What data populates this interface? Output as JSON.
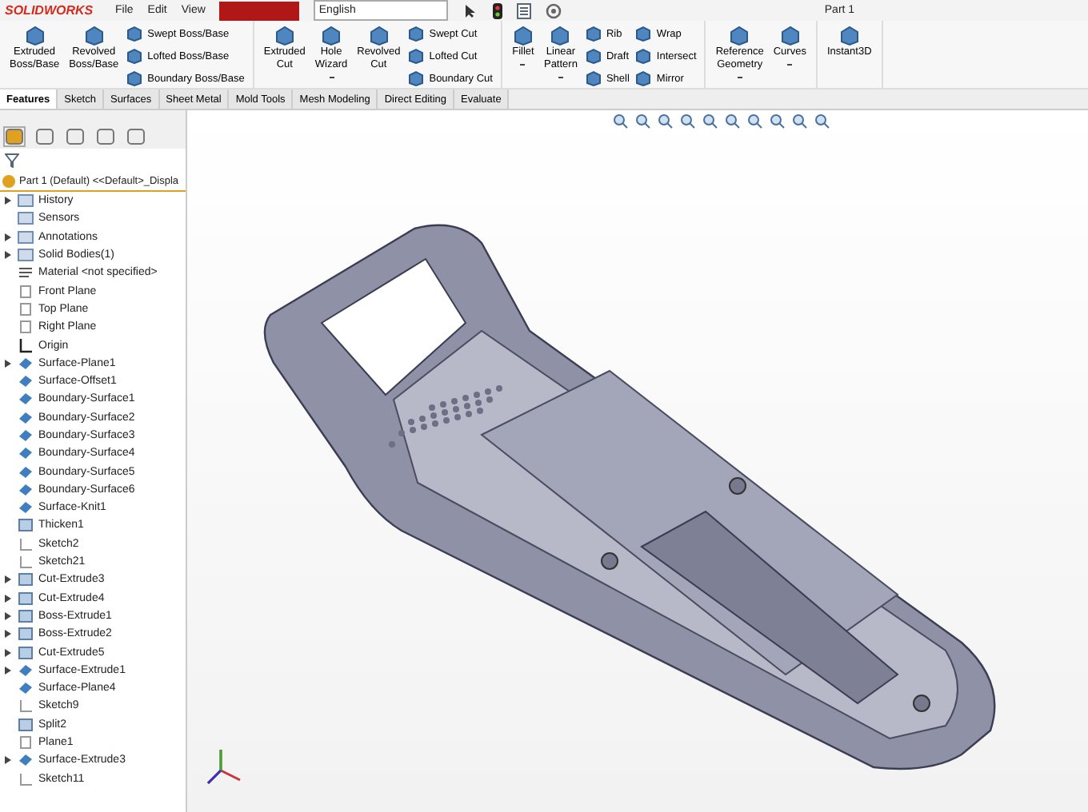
{
  "window": {
    "logo": "SOLIDWORKS",
    "title": "Part 1",
    "menus": [
      "File",
      "Edit",
      "View"
    ],
    "language": "English"
  },
  "ribbon": {
    "groups": [
      {
        "items": [
          {
            "kind": "large",
            "lines": [
              "Extruded",
              "Boss/Base"
            ],
            "dropdown": false
          },
          {
            "kind": "large",
            "lines": [
              "Revolved",
              "Boss/Base"
            ],
            "dropdown": false
          },
          {
            "kind": "stack",
            "labels": [
              "Swept Boss/Base",
              "Lofted Boss/Base",
              "Boundary Boss/Base"
            ]
          }
        ]
      },
      {
        "items": [
          {
            "kind": "large",
            "lines": [
              "Extruded",
              "Cut"
            ],
            "dropdown": false
          },
          {
            "kind": "large",
            "lines": [
              "Hole",
              "Wizard"
            ],
            "dropdown": true
          },
          {
            "kind": "large",
            "lines": [
              "Revolved",
              "Cut"
            ],
            "dropdown": false
          },
          {
            "kind": "stack",
            "labels": [
              "Swept Cut",
              "Lofted Cut",
              "Boundary Cut"
            ]
          }
        ]
      },
      {
        "items": [
          {
            "kind": "large",
            "lines": [
              "Fillet"
            ],
            "dropdown": true
          },
          {
            "kind": "large",
            "lines": [
              "Linear",
              "Pattern"
            ],
            "dropdown": true
          },
          {
            "kind": "stack",
            "labels": [
              "Rib",
              "Draft",
              "Shell"
            ]
          },
          {
            "kind": "stack",
            "labels": [
              "Wrap",
              "Intersect",
              "Mirror"
            ]
          }
        ]
      },
      {
        "items": [
          {
            "kind": "large",
            "lines": [
              "Reference",
              "Geometry"
            ],
            "dropdown": true
          },
          {
            "kind": "large",
            "lines": [
              "Curves"
            ],
            "dropdown": true
          }
        ]
      },
      {
        "items": [
          {
            "kind": "large",
            "lines": [
              "Instant3D"
            ],
            "dropdown": false
          }
        ]
      }
    ]
  },
  "tabs": [
    {
      "label": "Features",
      "selected": true
    },
    {
      "label": "Sketch",
      "selected": false
    },
    {
      "label": "Surfaces",
      "selected": false
    },
    {
      "label": "Sheet Metal",
      "selected": false
    },
    {
      "label": "Mold Tools",
      "selected": false
    },
    {
      "label": "Mesh Modeling",
      "selected": false
    },
    {
      "label": "Direct Editing",
      "selected": false
    },
    {
      "label": "Evaluate",
      "selected": false
    }
  ],
  "tree": {
    "root": "Part 1 (Default) <<Default>_Displa",
    "items": [
      {
        "label": "History",
        "kind": "folder",
        "expandable": true
      },
      {
        "label": "Sensors",
        "kind": "folder",
        "expandable": false
      },
      {
        "label": "Annotations",
        "kind": "folder",
        "expandable": true
      },
      {
        "label": "Solid Bodies(1)",
        "kind": "folder",
        "expandable": true
      },
      {
        "label": "Material <not specified>",
        "kind": "material",
        "expandable": false
      },
      {
        "label": "Front Plane",
        "kind": "plane",
        "expandable": false
      },
      {
        "label": "Top Plane",
        "kind": "plane",
        "expandable": false
      },
      {
        "label": "Right Plane",
        "kind": "plane",
        "expandable": false
      },
      {
        "label": "Origin",
        "kind": "origin",
        "expandable": false
      },
      {
        "label": "Surface-Plane1",
        "kind": "surface",
        "expandable": true
      },
      {
        "label": "Surface-Offset1",
        "kind": "surface",
        "expandable": false
      },
      {
        "label": "Boundary-Surface1",
        "kind": "surface",
        "expandable": false
      },
      {
        "label": "Boundary-Surface2",
        "kind": "surface",
        "expandable": false
      },
      {
        "label": "Boundary-Surface3",
        "kind": "surface",
        "expandable": false
      },
      {
        "label": "Boundary-Surface4",
        "kind": "surface",
        "expandable": false
      },
      {
        "label": "Boundary-Surface5",
        "kind": "surface",
        "expandable": false
      },
      {
        "label": "Boundary-Surface6",
        "kind": "surface",
        "expandable": false
      },
      {
        "label": "Surface-Knit1",
        "kind": "surface",
        "expandable": false
      },
      {
        "label": "Thicken1",
        "kind": "feature",
        "expandable": false
      },
      {
        "label": "Sketch2",
        "kind": "sketch",
        "expandable": false
      },
      {
        "label": "Sketch21",
        "kind": "sketch",
        "expandable": false
      },
      {
        "label": "Cut-Extrude3",
        "kind": "feature",
        "expandable": true
      },
      {
        "label": "Cut-Extrude4",
        "kind": "feature",
        "expandable": true
      },
      {
        "label": "Boss-Extrude1",
        "kind": "feature",
        "expandable": true
      },
      {
        "label": "Boss-Extrude2",
        "kind": "feature",
        "expandable": true
      },
      {
        "label": "Cut-Extrude5",
        "kind": "feature",
        "expandable": true
      },
      {
        "label": "Surface-Extrude1",
        "kind": "surface",
        "expandable": true
      },
      {
        "label": "Surface-Plane4",
        "kind": "surface",
        "expandable": false
      },
      {
        "label": "Sketch9",
        "kind": "sketch",
        "expandable": false
      },
      {
        "label": "Split2",
        "kind": "feature",
        "expandable": false
      },
      {
        "label": "Plane1",
        "kind": "plane",
        "expandable": false
      },
      {
        "label": "Surface-Extrude3",
        "kind": "surface",
        "expandable": true
      },
      {
        "label": "Sketch11",
        "kind": "sketch",
        "expandable": false
      }
    ]
  }
}
